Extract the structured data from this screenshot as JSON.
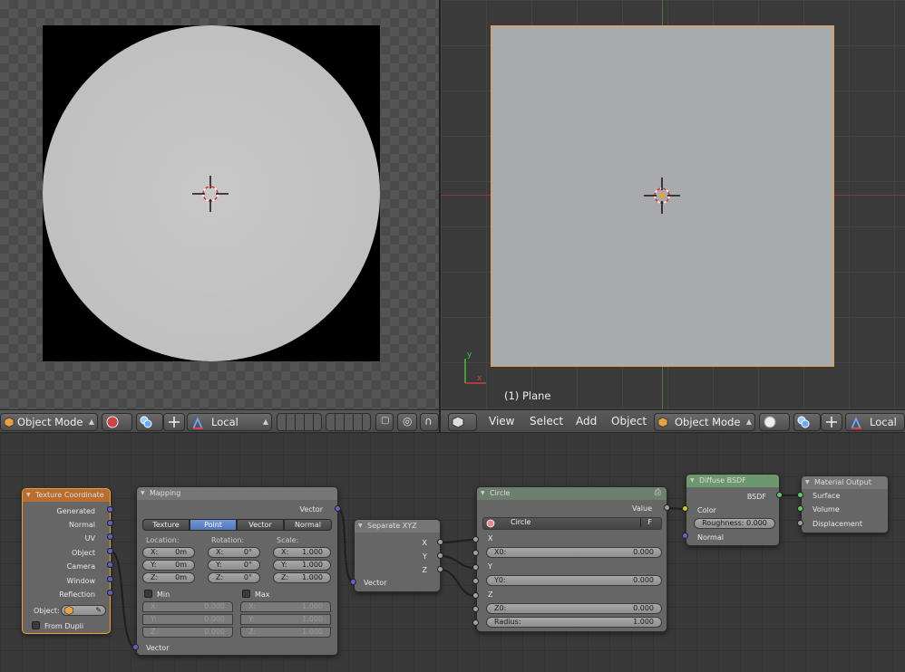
{
  "left_viewport": {
    "image_shape": "circle"
  },
  "right_viewport": {
    "object_label": "(1) Plane",
    "axis_x": "x",
    "axis_y": "y"
  },
  "left_header": {
    "mode": "Object Mode",
    "pivot": "Local"
  },
  "right_header": {
    "menus": [
      "View",
      "Select",
      "Add",
      "Object"
    ],
    "mode": "Object Mode",
    "pivot": "Local"
  },
  "nodes": {
    "texture_coordinate": {
      "title": "Texture Coordinate",
      "outputs": [
        "Generated",
        "Normal",
        "UV",
        "Object",
        "Camera",
        "Window",
        "Reflection"
      ],
      "object_label": "Object:",
      "from_dupli": "From Dupli"
    },
    "mapping": {
      "title": "Mapping",
      "output": "Vector",
      "tabs": [
        "Texture",
        "Point",
        "Vector",
        "Normal"
      ],
      "active_tab": "Point",
      "location_label": "Location:",
      "rotation_label": "Rotation:",
      "scale_label": "Scale:",
      "location": [
        {
          "axis": "X:",
          "value": "0m"
        },
        {
          "axis": "Y:",
          "value": "0m"
        },
        {
          "axis": "Z:",
          "value": "0m"
        }
      ],
      "rotation": [
        {
          "axis": "X:",
          "value": "0°"
        },
        {
          "axis": "Y:",
          "value": "0°"
        },
        {
          "axis": "Z:",
          "value": "0°"
        }
      ],
      "scale": [
        {
          "axis": "X:",
          "value": "1.000"
        },
        {
          "axis": "Y:",
          "value": "1.000"
        },
        {
          "axis": "Z:",
          "value": "1.000"
        }
      ],
      "min_label": "Min",
      "max_label": "Max",
      "min": [
        {
          "axis": "X:",
          "value": "0.000"
        },
        {
          "axis": "Y:",
          "value": "0.000"
        },
        {
          "axis": "Z:",
          "value": "0.000"
        }
      ],
      "max": [
        {
          "axis": "X:",
          "value": "1.000"
        },
        {
          "axis": "Y:",
          "value": "1.000"
        },
        {
          "axis": "Z:",
          "value": "1.000"
        }
      ],
      "input": "Vector"
    },
    "separate_xyz": {
      "title": "Separate XYZ",
      "outputs": [
        "X",
        "Y",
        "Z"
      ],
      "input": "Vector"
    },
    "circle": {
      "title": "Circle",
      "output": "Value",
      "script_name": "Circle",
      "script_flag": "F",
      "inputs": [
        {
          "label": "X",
          "value": null
        },
        {
          "label": "X0:",
          "value": "0.000"
        },
        {
          "label": "Y",
          "value": null
        },
        {
          "label": "Y0:",
          "value": "0.000"
        },
        {
          "label": "Z",
          "value": null
        },
        {
          "label": "Z0:",
          "value": "0.000"
        },
        {
          "label": "Radius:",
          "value": "1.000"
        }
      ]
    },
    "diffuse_bsdf": {
      "title": "Diffuse BSDF",
      "output": "BSDF",
      "color_label": "Color",
      "roughness": "Roughness: 0.000",
      "normal_label": "Normal"
    },
    "material_output": {
      "title": "Material Output",
      "inputs": [
        "Surface",
        "Volume",
        "Displacement"
      ]
    }
  }
}
